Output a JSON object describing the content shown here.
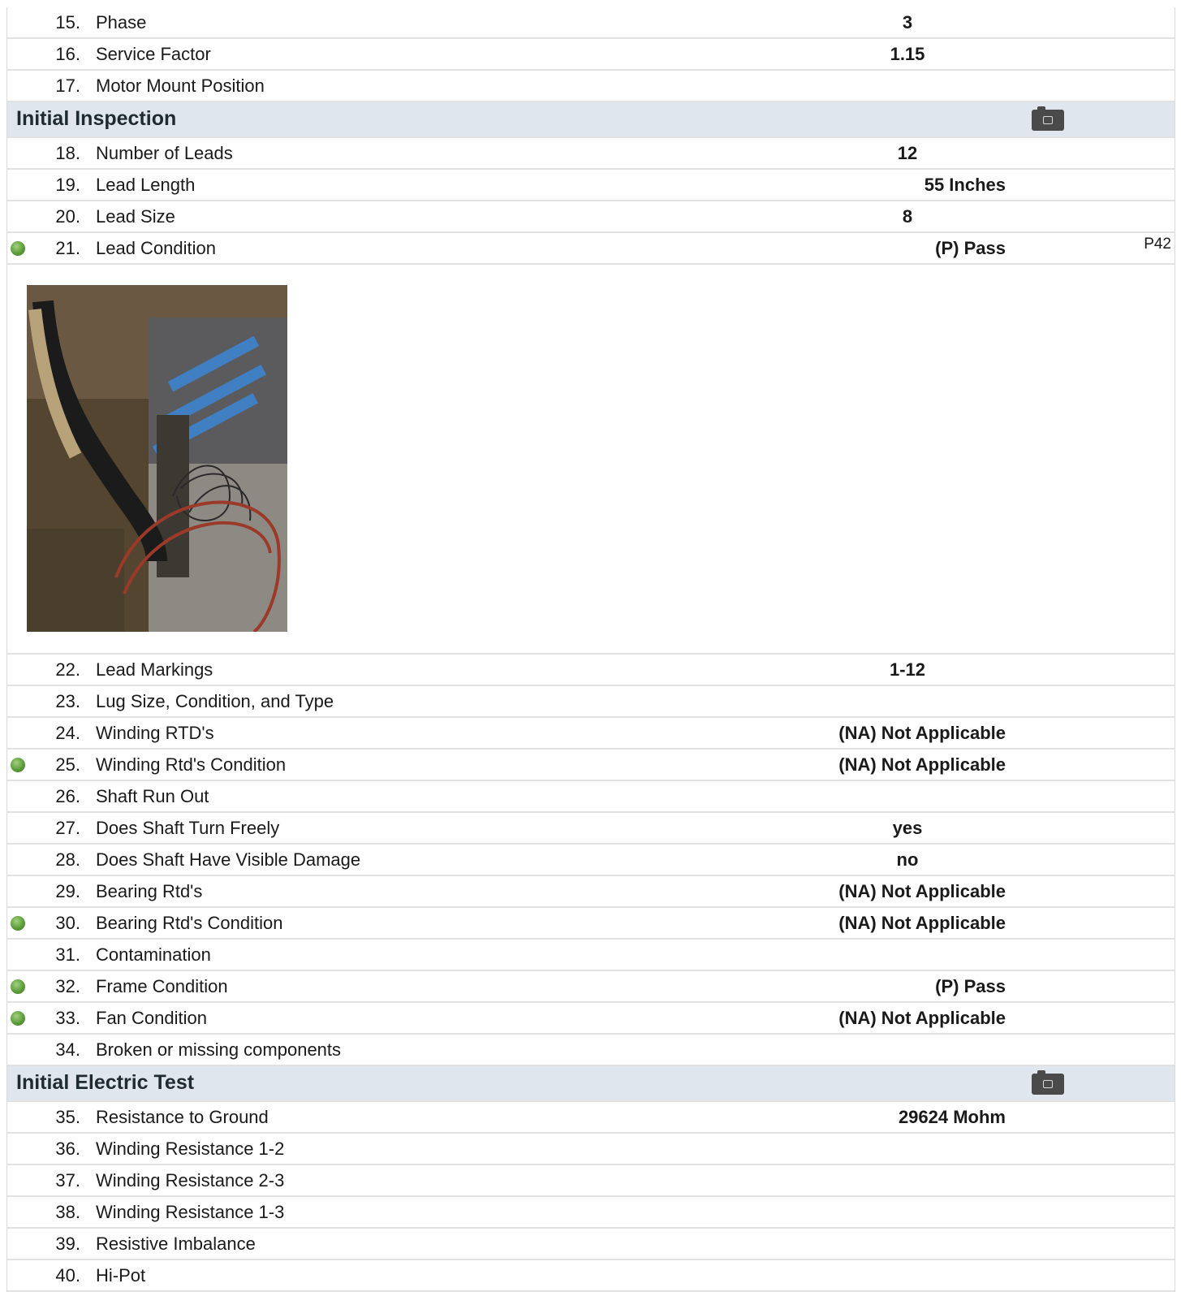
{
  "rows_a": [
    {
      "num": "15.",
      "label": "Phase",
      "value": "3"
    },
    {
      "num": "16.",
      "label": "Service Factor",
      "value": "1.15"
    },
    {
      "num": "17.",
      "label": "Motor Mount Position",
      "value": ""
    }
  ],
  "section1": {
    "title": "Initial Inspection",
    "icon": "camera-icon"
  },
  "rows_b": [
    {
      "num": "18.",
      "label": "Number of Leads",
      "value": "12"
    },
    {
      "num": "19.",
      "label": "Lead Length",
      "value": "55 Inches"
    },
    {
      "num": "20.",
      "label": "Lead Size",
      "value": "8"
    },
    {
      "num": "21.",
      "label": "Lead Condition",
      "value": "(P) Pass",
      "ref": "P42",
      "status": "pass"
    }
  ],
  "rows_c": [
    {
      "num": "22.",
      "label": "Lead Markings",
      "value": "1-12"
    },
    {
      "num": "23.",
      "label": "Lug Size, Condition, and Type",
      "value": ""
    },
    {
      "num": "24.",
      "label": "Winding RTD's",
      "value": "(NA) Not Applicable"
    },
    {
      "num": "25.",
      "label": "Winding Rtd's Condition",
      "value": "(NA) Not Applicable",
      "status": "pass"
    },
    {
      "num": "26.",
      "label": "Shaft Run Out",
      "value": ""
    },
    {
      "num": "27.",
      "label": "Does Shaft Turn Freely",
      "value": "yes"
    },
    {
      "num": "28.",
      "label": "Does Shaft Have Visible Damage",
      "value": "no"
    },
    {
      "num": "29.",
      "label": "Bearing Rtd's",
      "value": "(NA) Not Applicable"
    },
    {
      "num": "30.",
      "label": "Bearing Rtd's Condition",
      "value": "(NA) Not Applicable",
      "status": "pass"
    },
    {
      "num": "31.",
      "label": "Contamination",
      "value": ""
    },
    {
      "num": "32.",
      "label": "Frame Condition",
      "value": "(P) Pass",
      "status": "pass"
    },
    {
      "num": "33.",
      "label": "Fan Condition",
      "value": "(NA) Not Applicable",
      "status": "pass"
    },
    {
      "num": "34.",
      "label": "Broken or missing components",
      "value": ""
    }
  ],
  "section2": {
    "title": "Initial Electric Test",
    "icon": "camera-icon"
  },
  "rows_d": [
    {
      "num": "35.",
      "label": "Resistance to Ground",
      "value": "29624 Mohm"
    },
    {
      "num": "36.",
      "label": "Winding Resistance 1-2",
      "value": ""
    },
    {
      "num": "37.",
      "label": "Winding Resistance 2-3",
      "value": ""
    },
    {
      "num": "38.",
      "label": "Winding Resistance 1-3",
      "value": ""
    },
    {
      "num": "39.",
      "label": "Resistive Imbalance",
      "value": ""
    },
    {
      "num": "40.",
      "label": "Hi-Pot",
      "value": ""
    }
  ],
  "colors": {
    "section_bg": "#dfe6ed",
    "status_pass": "#5d9c3b",
    "divider": "#e2e2e2"
  }
}
